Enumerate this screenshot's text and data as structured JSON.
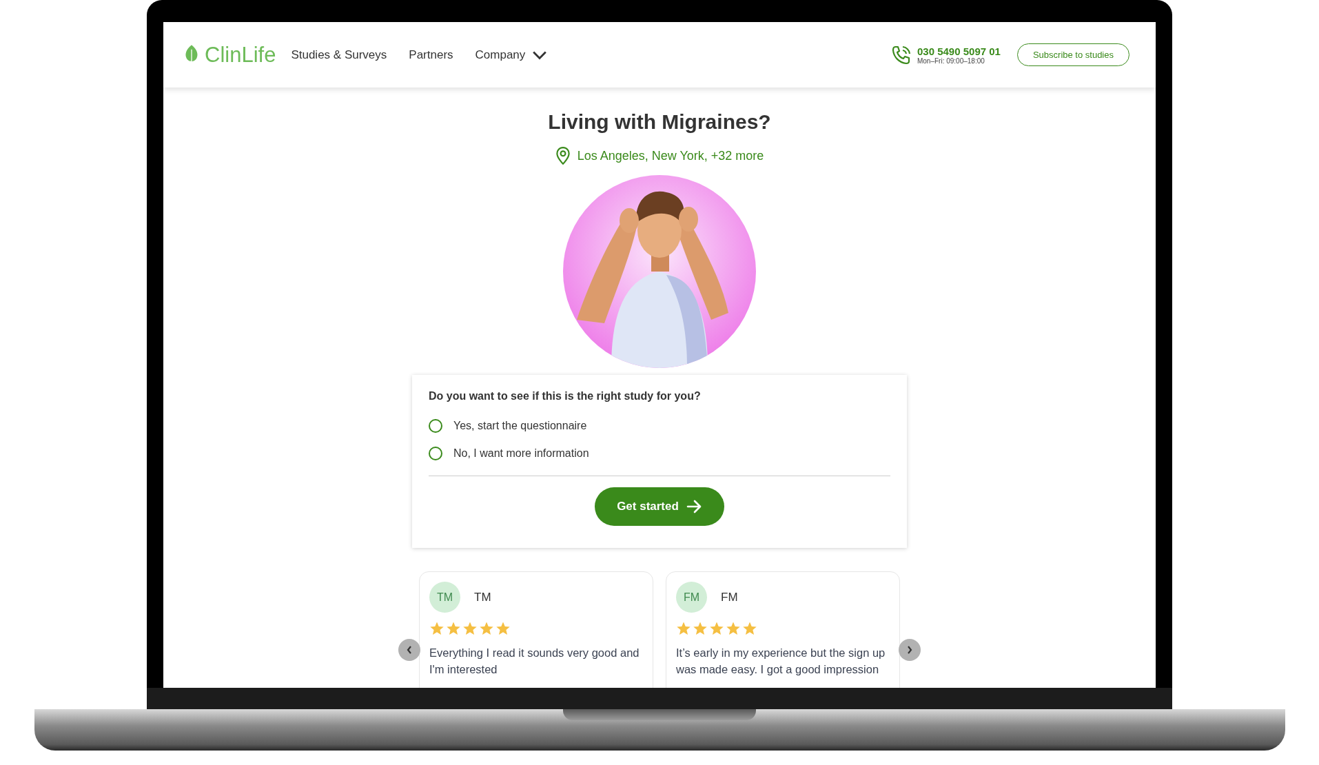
{
  "nav": {
    "logo": "ClinLife",
    "links": [
      {
        "label": "Studies & Surveys",
        "dropdown": false
      },
      {
        "label": "Partners",
        "dropdown": false
      },
      {
        "label": "Company",
        "dropdown": true
      }
    ],
    "phone": "030 5490 5097 01",
    "hours": "Mon–Fri: 09:00–18:00",
    "subscribe": "Subscribe to studies"
  },
  "hero": {
    "title": "Living with Migraines?",
    "locations": "Los Angeles, New York, +32 more"
  },
  "question": {
    "prompt": "Do you want to see if this is the right study for you?",
    "options": [
      {
        "label": "Yes, start the questionnaire",
        "selected": false
      },
      {
        "label": "No, I want more information",
        "selected": false
      }
    ],
    "button": "Get started"
  },
  "reviews": [
    {
      "initials": "TM",
      "name": "TM",
      "stars": 5,
      "text": "Everything I read it sounds very good and I'm interested"
    },
    {
      "initials": "FM",
      "name": "FM",
      "stars": 5,
      "text": "It’s early in my experience but the sign up was made easy. I got a good impression"
    }
  ]
}
